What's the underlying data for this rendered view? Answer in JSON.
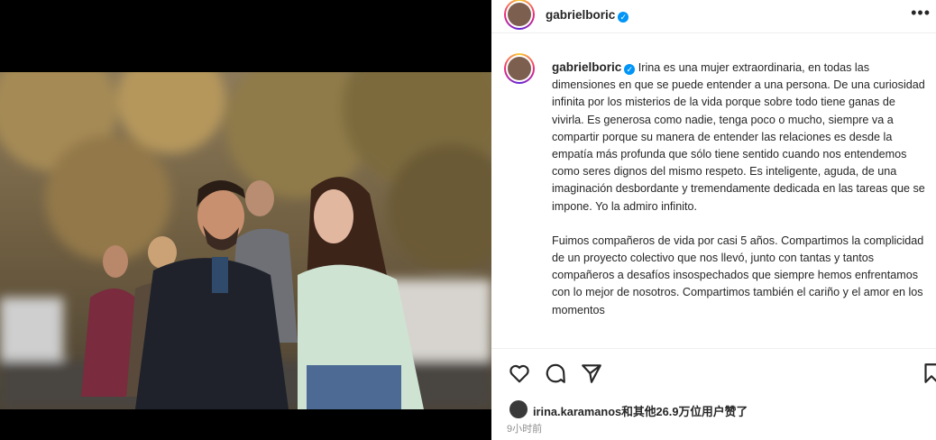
{
  "post": {
    "username": "gabrielboric",
    "header_username": "gabrielboric",
    "verified_mark": "✓",
    "more_label": "•••",
    "caption": [
      "Irina es una mujer extraordinaria, en todas las dimensiones en que se puede entender a una persona. De una curiosidad infinita por los misterios de la vida porque sobre todo tiene ganas de vivirla. Es generosa como nadie, tenga poco o mucho, siempre va a compartir porque su manera de entender las relaciones es desde la empatía más profunda que sólo tiene sentido cuando nos entendemos como seres dignos del mismo respeto. Es inteligente, aguda, de una imaginación desbordante y tremendamente dedicada en las tareas que se impone. Yo la admiro infinito.",
      "Fuimos compañeros de vida por casi 5 años. Compartimos la complicidad de un proyecto colectivo que nos llevó, junto con tantas y tantos compañeros a desafíos insospechados que siempre hemos enfrentamos con lo mejor de nosotros. Compartimos también el cariño y el amor en los momentos"
    ],
    "likes_text": "irina.karamanos和其他26.9万位用户赞了",
    "timestamp": "9小时前"
  },
  "icons": {
    "like": "heart-icon",
    "comment": "comment-icon",
    "share": "send-icon",
    "save": "bookmark-icon",
    "verified": "verified-badge-icon",
    "more": "more-options-icon"
  },
  "colors": {
    "text": "#262626",
    "secondary": "#8e8e8e",
    "verified": "#0095f6",
    "border": "#efefef"
  }
}
